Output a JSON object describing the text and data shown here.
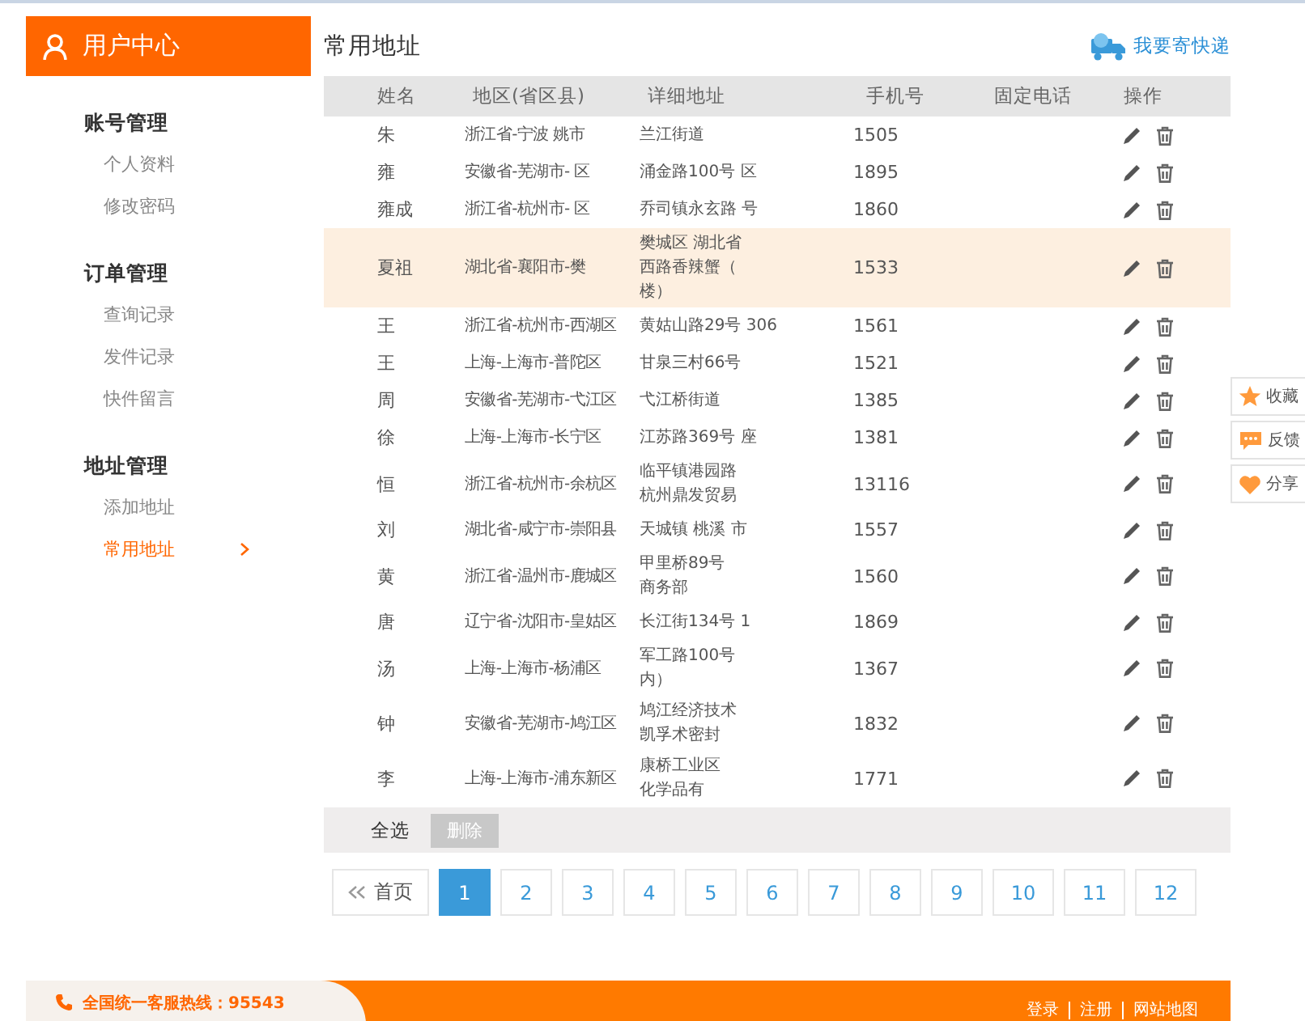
{
  "sidebar": {
    "title": "用户中心",
    "groups": [
      {
        "label": "账号管理",
        "items": [
          {
            "label": "个人资料",
            "selected": false
          },
          {
            "label": "修改密码",
            "selected": false
          }
        ]
      },
      {
        "label": "订单管理",
        "items": [
          {
            "label": "查询记录",
            "selected": false
          },
          {
            "label": "发件记录",
            "selected": false
          },
          {
            "label": "快件留言",
            "selected": false
          }
        ]
      },
      {
        "label": "地址管理",
        "items": [
          {
            "label": "添加地址",
            "selected": false
          },
          {
            "label": "常用地址",
            "selected": true
          }
        ]
      }
    ]
  },
  "page_title": "常用地址",
  "send_link": "我要寄快递",
  "table": {
    "columns": [
      "姓名",
      "地区(省区县)",
      "详细地址",
      "手机号",
      "固定电话",
      "操作"
    ],
    "rows": [
      {
        "name": "朱",
        "region": "浙江省-宁波 姚市",
        "address": [
          "兰江街道"
        ],
        "mobile": "1505",
        "highlighted": false
      },
      {
        "name": "雍",
        "region": "安徽省-芜湖市- 区",
        "address": [
          "涌金路100号 区"
        ],
        "mobile": "1895",
        "highlighted": false
      },
      {
        "name": "雍成",
        "region": "浙江省-杭州市- 区",
        "address": [
          "乔司镇永玄路 号"
        ],
        "mobile": "1860",
        "highlighted": false
      },
      {
        "name": "夏祖",
        "region": "湖北省-襄阳市-樊",
        "address": [
          "樊城区 湖北省",
          "西路香辣蟹（",
          "楼）"
        ],
        "mobile": "1533",
        "highlighted": true
      },
      {
        "name": "王",
        "region": "浙江省-杭州市-西湖区",
        "address": [
          "黄姑山路29号 306"
        ],
        "mobile": "1561",
        "highlighted": false
      },
      {
        "name": "王",
        "region": "上海-上海市-普陀区",
        "address": [
          "甘泉三村66号"
        ],
        "mobile": "1521",
        "highlighted": false
      },
      {
        "name": "周",
        "region": "安徽省-芜湖市-弋江区",
        "address": [
          "弋江桥街道"
        ],
        "mobile": "1385",
        "highlighted": false
      },
      {
        "name": "徐",
        "region": "上海-上海市-长宁区",
        "address": [
          "江苏路369号 座"
        ],
        "mobile": "1381",
        "highlighted": false
      },
      {
        "name": "恒",
        "region": "浙江省-杭州市-余杭区",
        "address": [
          "临平镇港园路",
          "杭州鼎发贸易"
        ],
        "mobile": "13116",
        "highlighted": false
      },
      {
        "name": "刘",
        "region": "湖北省-咸宁市-崇阳县",
        "address": [
          "天城镇 桃溪 市"
        ],
        "mobile": "1557",
        "highlighted": false
      },
      {
        "name": "黄",
        "region": "浙江省-温州市-鹿城区",
        "address": [
          "甲里桥89号",
          "商务部"
        ],
        "mobile": "1560",
        "highlighted": false
      },
      {
        "name": "唐",
        "region": "辽宁省-沈阳市-皇姑区",
        "address": [
          "长江街134号 1"
        ],
        "mobile": "1869",
        "highlighted": false
      },
      {
        "name": "汤",
        "region": "上海-上海市-杨浦区",
        "address": [
          "军工路100号",
          "内）"
        ],
        "mobile": "1367",
        "highlighted": false
      },
      {
        "name": "钟",
        "region": "安徽省-芜湖市-鸠江区",
        "address": [
          "鸠江经济技术",
          "凯孚术密封"
        ],
        "mobile": "1832",
        "highlighted": false
      },
      {
        "name": "李",
        "region": "上海-上海市-浦东新区",
        "address": [
          "康桥工业区",
          "化学品有"
        ],
        "mobile": "1771",
        "highlighted": false
      }
    ]
  },
  "bulk_bar": {
    "select_all": "全选",
    "delete": {
      "label": "删除",
      "disabled": true
    }
  },
  "pagination": {
    "first": "首页",
    "pages": [
      {
        "label": "1",
        "selected": true
      },
      {
        "label": "2",
        "selected": false
      },
      {
        "label": "3",
        "selected": false
      },
      {
        "label": "4",
        "selected": false
      },
      {
        "label": "5",
        "selected": false
      },
      {
        "label": "6",
        "selected": false
      },
      {
        "label": "7",
        "selected": false
      },
      {
        "label": "8",
        "selected": false
      },
      {
        "label": "9",
        "selected": false
      },
      {
        "label": "10",
        "selected": false
      },
      {
        "label": "11",
        "selected": false
      },
      {
        "label": "12",
        "selected": false
      }
    ]
  },
  "float_bar": [
    {
      "kind": "star",
      "label": "收藏"
    },
    {
      "kind": "chat",
      "label": "反馈"
    },
    {
      "kind": "heart",
      "label": "分享"
    }
  ],
  "footer": {
    "hotline": "全国统一客服热线：95543",
    "links": [
      "登录",
      "注册",
      "网站地图"
    ]
  }
}
